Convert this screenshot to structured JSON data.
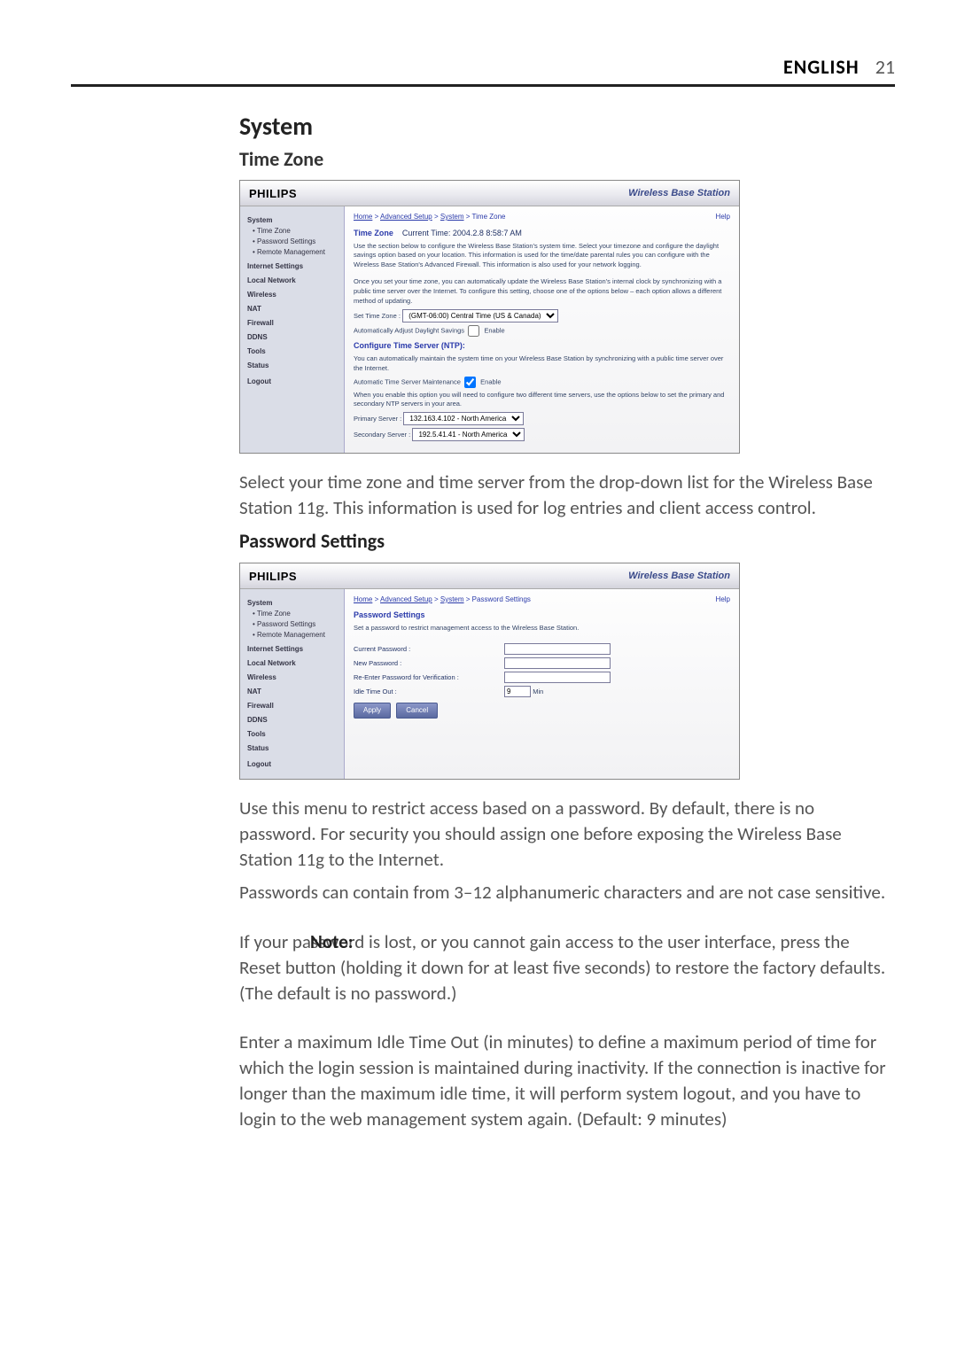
{
  "header": {
    "language": "ENGLISH",
    "page_number": "21"
  },
  "section1": {
    "title": "System",
    "subtitle": "Time Zone"
  },
  "shot1": {
    "logo": "PHILIPS",
    "tag": "Wireless Base Station",
    "crumb_home": "Home",
    "crumb_adv": "Advanced Setup",
    "crumb_sys": "System",
    "crumb_leaf": "Time Zone",
    "help": "Help",
    "side_system": "System",
    "side_timezone": "• Time Zone",
    "side_password": "• Password Settings",
    "side_remote": "• Remote Management",
    "side_internet": "Internet Settings",
    "side_local": "Local Network",
    "side_wireless": "Wireless",
    "side_nat": "NAT",
    "side_firewall": "Firewall",
    "side_ddns": "DDNS",
    "side_tools": "Tools",
    "side_status": "Status",
    "side_logout": "Logout",
    "tz_heading": "Time Zone",
    "tz_current": "Current Time: 2004.2.8 8:58:7 AM",
    "tz_para1": "Use the section below to configure the Wireless Base Station's system time. Select your timezone and configure the daylight savings option based on your location. This information is used for the time/date parental rules you can configure with the Wireless Base Station's Advanced Firewall. This information is also used for your network logging.",
    "tz_para2": "Once you set your time zone, you can automatically update the Wireless Base Station's internal clock by synchronizing with a public time server over the Internet. To configure this setting, choose one of the options below – each option allows a different method of updating.",
    "tz_setlabel": "Set Time Zone :",
    "tz_select": "(GMT-06:00) Central Time (US & Canada)",
    "tz_daylight": "Automatically Adjust Daylight Savings",
    "tz_enable": "Enable",
    "ntp_heading": "Configure Time Server (NTP):",
    "ntp_para": "You can automatically maintain the system time on your Wireless Base Station by synchronizing with a public time server over the Internet.",
    "ntp_auto": "Automatic Time Server Maintenance",
    "ntp_primary_lbl": "Primary Server :",
    "ntp_primary_val": "132.163.4.102 - North America",
    "ntp_secondary_lbl": "Secondary Server :",
    "ntp_secondary_val": "192.5.41.41 - North America"
  },
  "para_tz": "Select your time zone and time server from the drop-down list for the Wireless Base Station 11g. This information is used for log entries and client access control.",
  "section2": {
    "title": "Password Settings"
  },
  "shot2": {
    "logo": "PHILIPS",
    "tag": "Wireless Base Station",
    "crumb_home": "Home",
    "crumb_adv": "Advanced Setup",
    "crumb_sys": "System",
    "crumb_leaf": "Password Settings",
    "help": "Help",
    "side_system": "System",
    "side_timezone": "• Time Zone",
    "side_password": "• Password Settings",
    "side_remote": "• Remote Management",
    "side_internet": "Internet Settings",
    "side_local": "Local Network",
    "side_wireless": "Wireless",
    "side_nat": "NAT",
    "side_firewall": "Firewall",
    "side_ddns": "DDNS",
    "side_tools": "Tools",
    "side_status": "Status",
    "side_logout": "Logout",
    "heading": "Password Settings",
    "intro": "Set a password to restrict management access to the Wireless Base Station.",
    "cur_lbl": "Current Password :",
    "new_lbl": "New Password :",
    "re_lbl": "Re-Enter Password for Verification :",
    "idle_lbl": "Idle Time Out :",
    "idle_val": "9",
    "idle_unit": "Min",
    "btn_apply": "Apply",
    "btn_cancel": "Cancel"
  },
  "para_pw1": "Use this menu to restrict access based on a password. By default, there is no password. For security you should assign one before exposing the Wireless Base Station 11g to the Internet.",
  "para_pw2": "Passwords can contain from 3–12 alphanumeric characters and are not case sensitive.",
  "note_label": "Note:",
  "note_text": "If your password is lost, or you cannot gain access to the user interface, press the Reset button (holding it down for at least five seconds) to restore the factory defaults. (The default is no password.)",
  "para_idle": "Enter a maximum Idle Time Out (in minutes) to define a maximum period of time for which the login session is maintained during inactivity. If the connection is inactive for longer than the maximum idle time, it will perform system logout, and you have to login to the web management system again. (Default: 9 minutes)"
}
